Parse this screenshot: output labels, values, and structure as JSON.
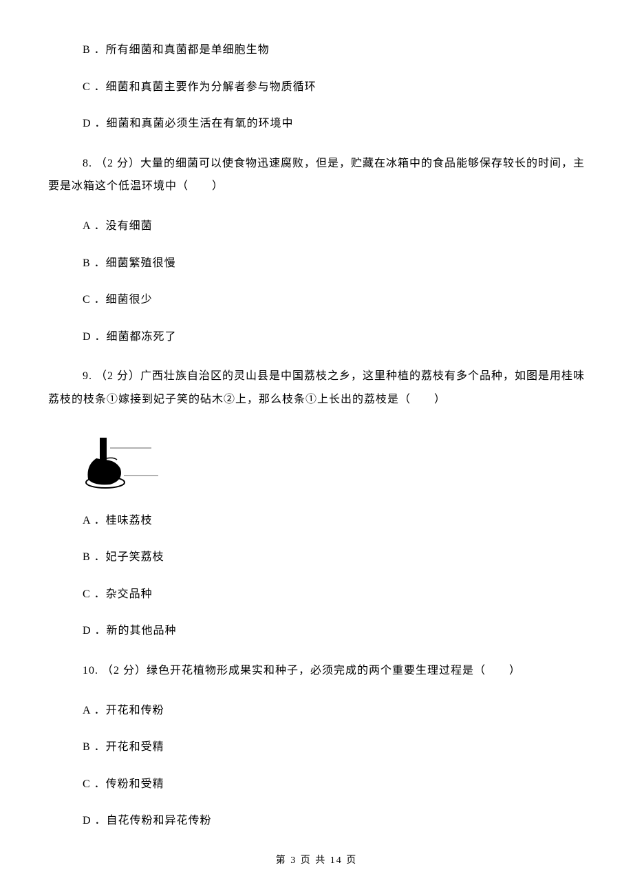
{
  "q7_tail": {
    "optionB": "B ．所有细菌和真菌都是单细胞生物",
    "optionC": "C ．细菌和真菌主要作为分解者参与物质循环",
    "optionD": "D ．细菌和真菌必须生活在有氧的环境中"
  },
  "q8": {
    "stem": "8. （2 分）大量的细菌可以使食物迅速腐败，但是，贮藏在冰箱中的食品能够保存较长的时间，主要是冰箱这个低温环境中（　　）",
    "optionA": "A ．没有细菌",
    "optionB": "B ．细菌繁殖很慢",
    "optionC": "C ．细菌很少",
    "optionD": "D ．细菌都冻死了"
  },
  "q9": {
    "stem": "9. （2 分）广西壮族自治区的灵山县是中国荔枝之乡，这里种植的荔枝有多个品种，如图是用桂味荔枝的枝条①嫁接到妃子笑的砧木②上，那么枝条①上长出的荔枝是（　　）",
    "optionA": "A ．桂味荔枝",
    "optionB": "B ．妃子笑荔枝",
    "optionC": "C ．杂交品种",
    "optionD": "D ．新的其他品种"
  },
  "q10": {
    "stem": "10. （2 分）绿色开花植物形成果实和种子，必须完成的两个重要生理过程是（　　）",
    "optionA": "A ．开花和传粉",
    "optionB": "B ．开花和受精",
    "optionC": "C ．传粉和受精",
    "optionD": "D ．自花传粉和异花传粉"
  },
  "footer": "第 3 页 共 14 页"
}
